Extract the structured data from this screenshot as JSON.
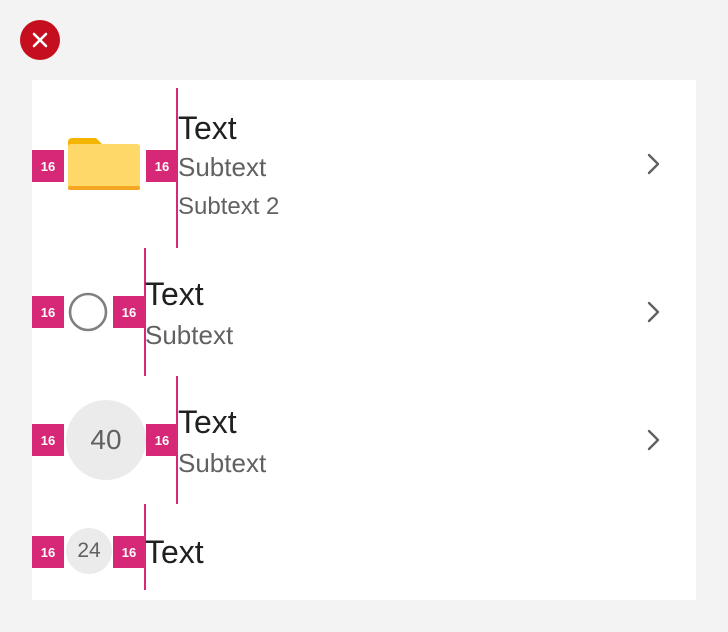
{
  "close_button": {
    "icon": "dismiss-icon",
    "color": "#c50f1f"
  },
  "accent_color": "#d62876",
  "rows": [
    {
      "spacing_left": "16",
      "spacing_right": "16",
      "media": "folder-icon",
      "title": "Text",
      "subtitle": "Subtext",
      "subtitle2": "Subtext 2",
      "chevron": "chevron-right-icon"
    },
    {
      "spacing_left": "16",
      "spacing_right": "16",
      "media": "circle-outline-icon",
      "title": "Text",
      "subtitle": "Subtext",
      "chevron": "chevron-right-icon"
    },
    {
      "spacing_left": "16",
      "spacing_right": "16",
      "avatar_label": "40",
      "title": "Text",
      "subtitle": "Subtext",
      "chevron": "chevron-right-icon"
    },
    {
      "spacing_left": "16",
      "spacing_right": "16",
      "avatar_label": "24",
      "title": "Text"
    }
  ]
}
